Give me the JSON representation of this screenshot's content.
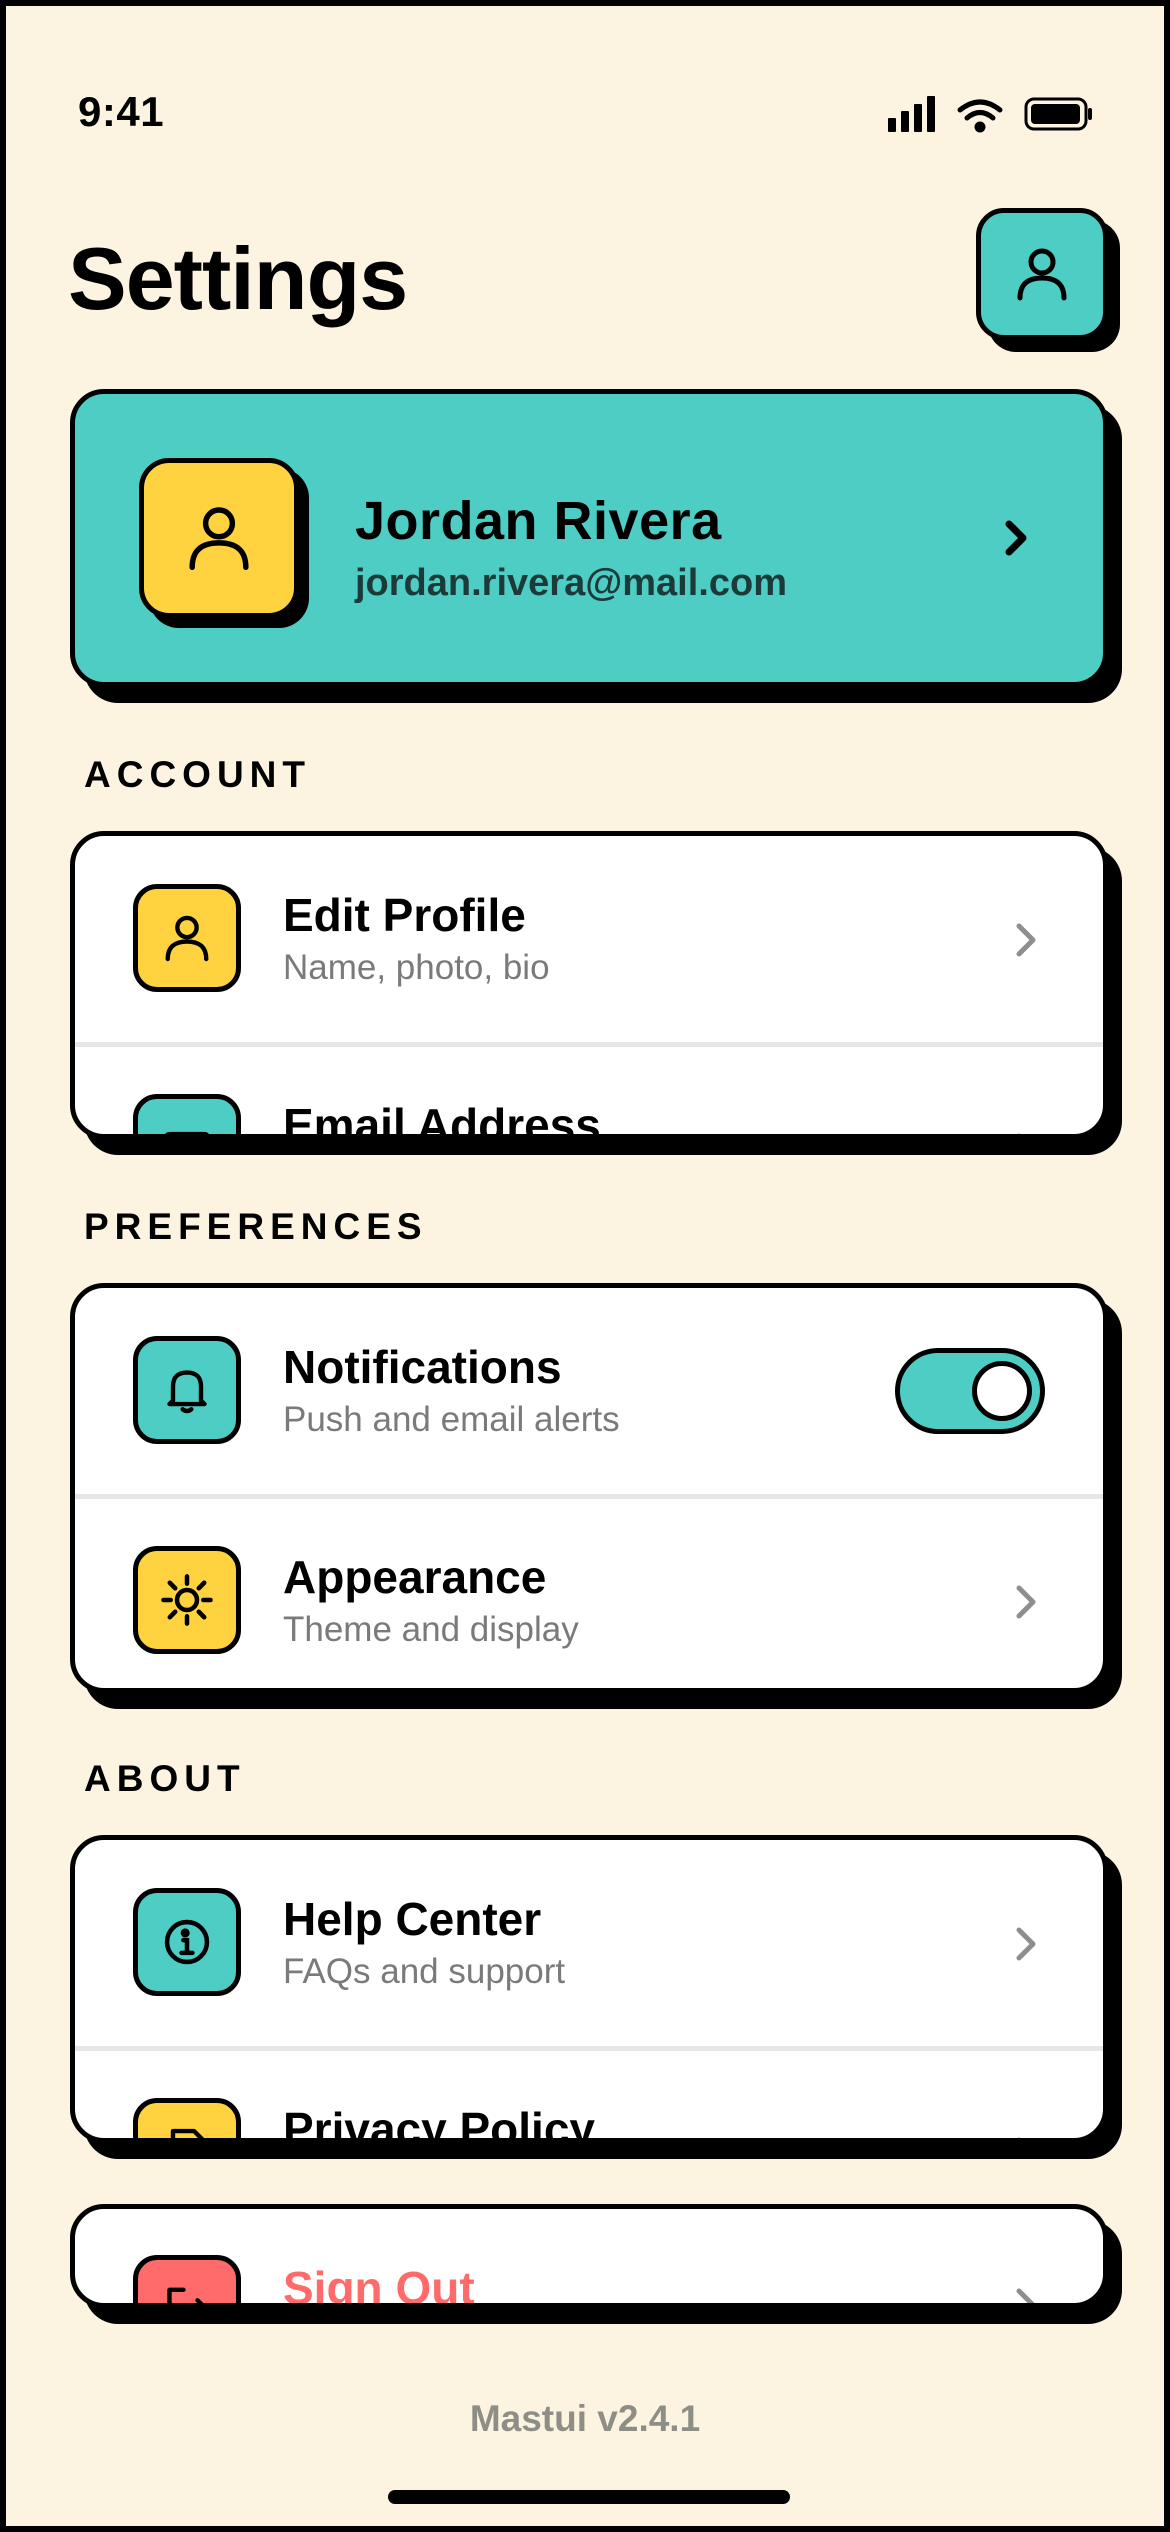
{
  "status_bar": {
    "time": "9:41"
  },
  "header": {
    "title": "Settings",
    "profile_button_icon": "person-icon"
  },
  "profile": {
    "name": "Jordan Rivera",
    "email": "jordan.rivera@mail.com",
    "avatar_icon": "person-icon"
  },
  "sections": {
    "account": {
      "label": "ACCOUNT",
      "items": [
        {
          "title": "Edit Profile",
          "subtitle": "Name, photo, bio",
          "icon": "person-icon"
        },
        {
          "title": "Email Address",
          "icon": "mail-icon"
        }
      ]
    },
    "preferences": {
      "label": "PREFERENCES",
      "items": [
        {
          "title": "Notifications",
          "subtitle": "Push and email alerts",
          "icon": "bell-icon",
          "toggle_on": true
        },
        {
          "title": "Appearance",
          "subtitle": "Theme and display",
          "icon": "sun-icon"
        }
      ]
    },
    "about": {
      "label": "ABOUT",
      "items": [
        {
          "title": "Help Center",
          "subtitle": "FAQs and support",
          "icon": "info-icon"
        },
        {
          "title": "Privacy Policy",
          "icon": "document-icon"
        }
      ]
    },
    "danger": {
      "items": [
        {
          "title": "Sign Out",
          "icon": "sign-out-icon"
        }
      ]
    }
  },
  "footer": {
    "version": "Mastui v2.4.1"
  },
  "colors": {
    "background": "#FCF4E1",
    "teal": "#4ECDC4",
    "yellow": "#FFD23F",
    "coral": "#FF6B6B",
    "ink": "#000000"
  }
}
